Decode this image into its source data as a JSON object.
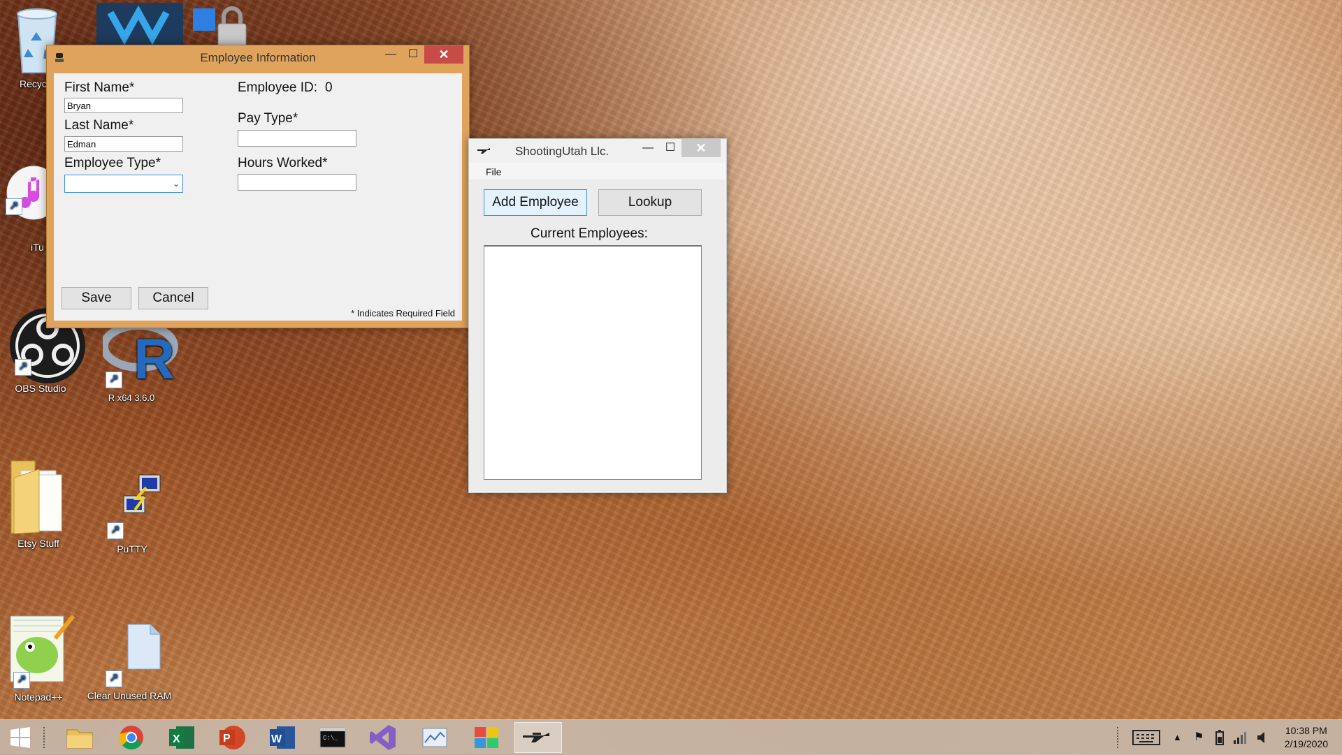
{
  "desktop": {
    "icons": [
      {
        "label": "Recycl",
        "icon": "recycle-bin-icon"
      },
      {
        "label": "iTu",
        "icon": "itunes-icon"
      },
      {
        "label": "OBS Studio",
        "icon": "obs-icon"
      },
      {
        "label": "R x64 3.6.0",
        "icon": "r-icon"
      },
      {
        "label": "Etsy Stuff",
        "icon": "folder-icon"
      },
      {
        "label": "PuTTY",
        "icon": "putty-icon"
      },
      {
        "label": "Notepad++",
        "icon": "notepadpp-icon"
      },
      {
        "label": "Clear Unused RAM",
        "icon": "file-icon"
      }
    ]
  },
  "employee_window": {
    "title": "Employee Information",
    "first_name_label": "First Name*",
    "first_name_value": "Bryan",
    "last_name_label": "Last Name*",
    "last_name_value": "Edman",
    "employee_type_label": "Employee Type*",
    "employee_type_value": "",
    "employee_id_label": "Employee ID:",
    "employee_id_value": "0",
    "pay_type_label": "Pay Type*",
    "pay_type_value": "",
    "hours_worked_label": "Hours Worked*",
    "hours_worked_value": "",
    "save_label": "Save",
    "cancel_label": "Cancel",
    "required_note": "* Indicates Required Field",
    "accent_color": "#e0a35d",
    "close_color": "#c74b46"
  },
  "main_window": {
    "title": "ShootingUtah Llc.",
    "menu_file": "File",
    "add_employee_label": "Add Employee",
    "lookup_label": "Lookup",
    "current_employees_label": "Current Employees:"
  },
  "taskbar": {
    "apps": [
      "start",
      "file-explorer",
      "chrome",
      "excel",
      "powerpoint",
      "word",
      "cmd",
      "visual-studio",
      "app-window",
      "paint",
      "rifle-app"
    ],
    "clock_time": "10:38 PM",
    "clock_date": "2/19/2020"
  }
}
